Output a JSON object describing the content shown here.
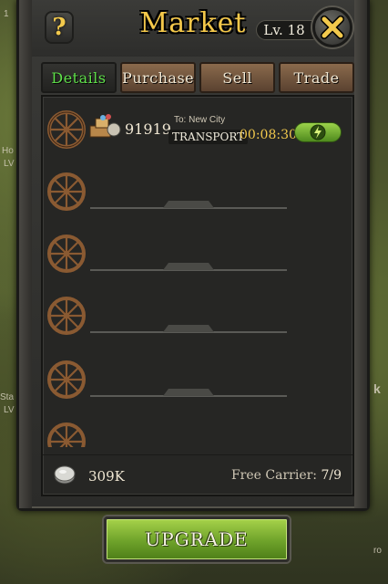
{
  "header": {
    "title": "Market",
    "level": "Lv. 18",
    "help_label": "?"
  },
  "tabs": [
    {
      "label": "Details",
      "active": true
    },
    {
      "label": "Purchase",
      "active": false
    },
    {
      "label": "Sell",
      "active": false
    },
    {
      "label": "Trade",
      "active": false
    }
  ],
  "slots": [
    {
      "state": "active",
      "amount": "91919",
      "destination": "To: New City",
      "type": "TRANSPORT",
      "timer": "00:08:30"
    },
    {
      "state": "empty"
    },
    {
      "state": "empty"
    },
    {
      "state": "empty"
    },
    {
      "state": "empty"
    },
    {
      "state": "empty"
    }
  ],
  "footer": {
    "silver": "309K",
    "carrier_label": "Free Carrier:",
    "carrier_value": "7/9"
  },
  "upgrade_label": "UPGRADE",
  "background": {
    "left_labels": [
      "1",
      "Ho",
      "LV",
      "Sta",
      "LV"
    ],
    "right_labels": [
      "k",
      "ro"
    ]
  },
  "colors": {
    "accent_gold": "#f4c84a",
    "active_tab_text": "#5fe04a",
    "button_green": "#6ea22a",
    "tab_brown": "#7a5c40"
  }
}
